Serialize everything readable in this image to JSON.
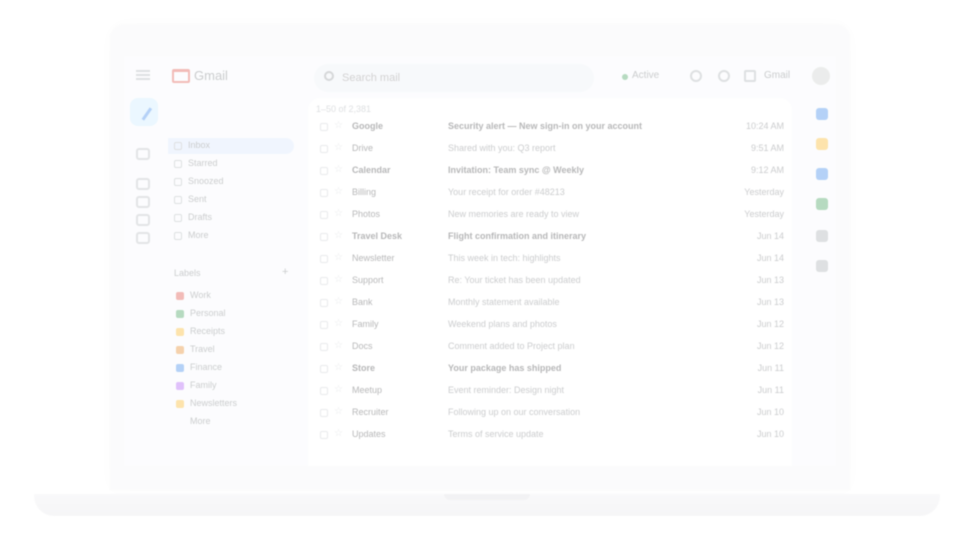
{
  "app": {
    "logo_text": "Gmail",
    "search_placeholder": "Search mail",
    "status_text": "Active",
    "support_label": "Gmail"
  },
  "sidebar": {
    "items": [
      {
        "label": "Inbox",
        "icon": "inbox-icon",
        "active": true
      },
      {
        "label": "Starred",
        "icon": "star-icon"
      },
      {
        "label": "Snoozed",
        "icon": "clock-icon"
      },
      {
        "label": "Sent",
        "icon": "send-icon"
      },
      {
        "label": "Drafts",
        "icon": "draft-icon"
      },
      {
        "label": "More",
        "icon": "chevron-down-icon"
      }
    ],
    "labels_title": "Labels",
    "labels_add": "+",
    "labels": [
      {
        "label": "Work",
        "color": "#d93025"
      },
      {
        "label": "Personal",
        "color": "#1e8e3e"
      },
      {
        "label": "Receipts",
        "color": "#f9ab00"
      },
      {
        "label": "Travel",
        "color": "#e37400"
      },
      {
        "label": "Finance",
        "color": "#1a73e8"
      },
      {
        "label": "Family",
        "color": "#a142f4"
      },
      {
        "label": "Newsletters",
        "color": "#f9ab00"
      }
    ],
    "more_labels": "More"
  },
  "list": {
    "toolbar_text": "1–50 of 2,381",
    "rows": [
      {
        "sender": "Google",
        "subject": "Security alert — New sign-in on your account",
        "date": "10:24 AM",
        "unread": true
      },
      {
        "sender": "Drive",
        "subject": "Shared with you: Q3 report",
        "date": "9:51 AM",
        "unread": false
      },
      {
        "sender": "Calendar",
        "subject": "Invitation: Team sync @ Weekly",
        "date": "9:12 AM",
        "unread": true
      },
      {
        "sender": "Billing",
        "subject": "Your receipt for order #48213",
        "date": "Yesterday",
        "unread": false
      },
      {
        "sender": "Photos",
        "subject": "New memories are ready to view",
        "date": "Yesterday",
        "unread": false
      },
      {
        "sender": "Travel Desk",
        "subject": "Flight confirmation and itinerary",
        "date": "Jun 14",
        "unread": true
      },
      {
        "sender": "Newsletter",
        "subject": "This week in tech: highlights",
        "date": "Jun 14",
        "unread": false
      },
      {
        "sender": "Support",
        "subject": "Re: Your ticket has been updated",
        "date": "Jun 13",
        "unread": false
      },
      {
        "sender": "Bank",
        "subject": "Monthly statement available",
        "date": "Jun 13",
        "unread": false
      },
      {
        "sender": "Family",
        "subject": "Weekend plans and photos",
        "date": "Jun 12",
        "unread": false
      },
      {
        "sender": "Docs",
        "subject": "Comment added to Project plan",
        "date": "Jun 12",
        "unread": false
      },
      {
        "sender": "Store",
        "subject": "Your package has shipped",
        "date": "Jun 11",
        "unread": true
      },
      {
        "sender": "Meetup",
        "subject": "Event reminder: Design night",
        "date": "Jun 11",
        "unread": false
      },
      {
        "sender": "Recruiter",
        "subject": "Following up on our conversation",
        "date": "Jun 10",
        "unread": false
      },
      {
        "sender": "Updates",
        "subject": "Terms of service update",
        "date": "Jun 10",
        "unread": false
      }
    ]
  },
  "colors": {
    "accent": "#1a73e8",
    "compose": "#c2e7ff",
    "active_nav": "#d3e3fd",
    "side_icons": [
      "#1a73e8",
      "#f9ab00",
      "#1a73e8",
      "#1e8e3e",
      "#9aa0a6",
      "#9aa0a6"
    ]
  }
}
